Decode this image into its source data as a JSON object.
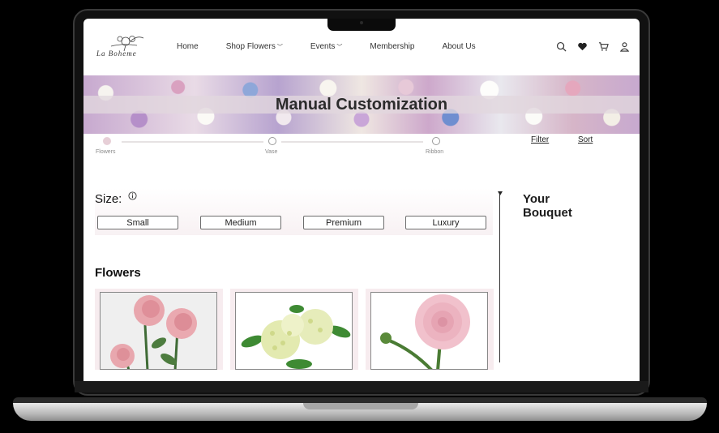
{
  "brand": {
    "logo_text": "La Boheme"
  },
  "nav": {
    "items": [
      {
        "label": "Home",
        "dropdown": false
      },
      {
        "label": "Shop Flowers",
        "dropdown": true
      },
      {
        "label": "Events",
        "dropdown": true
      },
      {
        "label": "Membership",
        "dropdown": false
      },
      {
        "label": "About Us",
        "dropdown": false
      }
    ]
  },
  "header_icons": [
    "search-icon",
    "heart-icon",
    "cart-icon",
    "user-icon"
  ],
  "banner": {
    "title": "Manual Customization"
  },
  "stepper": {
    "steps": [
      {
        "label": "Flowers",
        "active": true
      },
      {
        "label": "Vase",
        "active": false
      },
      {
        "label": "Ribbon",
        "active": false
      }
    ]
  },
  "controls": {
    "filter_label": "Filter",
    "sort_label": "Sort"
  },
  "size": {
    "title": "Size:",
    "options": [
      "Small",
      "Medium",
      "Premium",
      "Luxury"
    ]
  },
  "bouquet": {
    "title": "Your Bouquet"
  },
  "flowers": {
    "title": "Flowers",
    "items": [
      "pink-rose-image",
      "white-hydrangea-image",
      "pink-ranunculus-image"
    ]
  },
  "colors": {
    "accent": "#e7cfd7",
    "panel": "#f8f1f3",
    "text": "#222222"
  }
}
